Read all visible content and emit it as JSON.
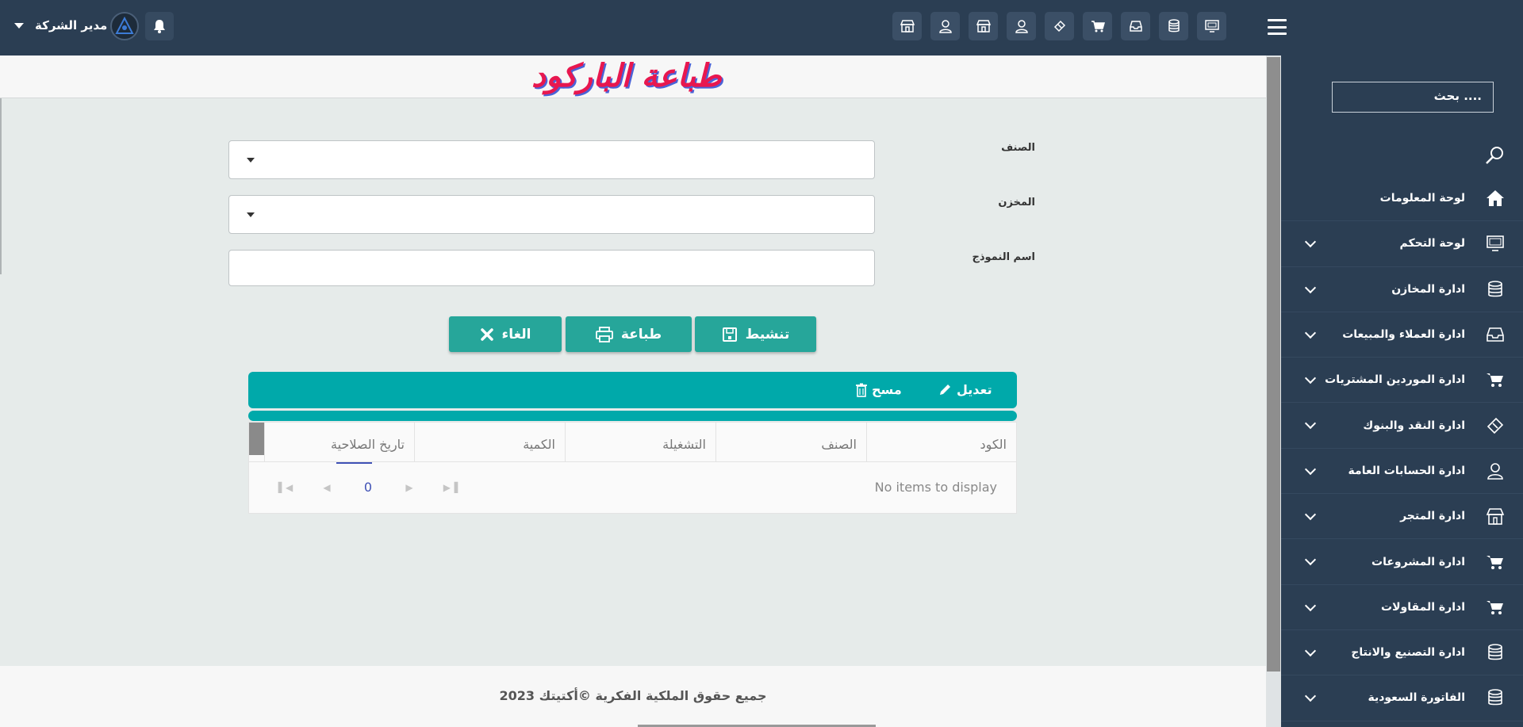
{
  "topbar": {
    "user_label": "مدير الشركة",
    "top_icons": [
      "monitor-icon",
      "database-icon",
      "inbox-icon",
      "cart-icon",
      "ticket-icon",
      "user-icon",
      "store-icon",
      "user-icon",
      "store-icon"
    ]
  },
  "sidebar": {
    "search_placeholder": "بحث ....",
    "items": [
      {
        "label": "لوحة المعلومات",
        "icon": "home-icon",
        "has_children": false
      },
      {
        "label": "لوحة التحكم",
        "icon": "monitor-icon",
        "has_children": true
      },
      {
        "label": "ادارة المخازن",
        "icon": "database-icon",
        "has_children": true
      },
      {
        "label": "ادارة العملاء والمبيعات",
        "icon": "inbox-icon",
        "has_children": true
      },
      {
        "label": "ادارة الموردين المشتريات",
        "icon": "cart-icon",
        "has_children": true
      },
      {
        "label": "ادارة النقد والبنوك",
        "icon": "ticket-icon",
        "has_children": true
      },
      {
        "label": "ادارة الحسابات العامة",
        "icon": "user-icon",
        "has_children": true
      },
      {
        "label": "ادارة المتجر",
        "icon": "store-icon",
        "has_children": true
      },
      {
        "label": "ادارة المشروعات",
        "icon": "cart-icon",
        "has_children": true
      },
      {
        "label": "ادارة المقاولات",
        "icon": "cart-icon",
        "has_children": true
      },
      {
        "label": "ادارة التصنيع والانتاج",
        "icon": "database-icon",
        "has_children": true
      },
      {
        "label": "الفاتورة السعودية",
        "icon": "database-icon",
        "has_children": true
      }
    ]
  },
  "page": {
    "title": "طباعة الباركود"
  },
  "form": {
    "item_label": "الصنف",
    "item_value": "",
    "store_label": "المخزن",
    "store_value": "",
    "template_label": "اسم النموذج",
    "template_value": ""
  },
  "actions": {
    "activate": "تنشيط",
    "print": "طباعة",
    "cancel": "الغاء"
  },
  "grid": {
    "edit": "تعديل",
    "delete": "مسح",
    "columns": [
      "الكود",
      "الصنف",
      "التشغيلة",
      "الكمية",
      "تاريخ الصلاحية"
    ],
    "empty_message": "No items to display",
    "page_number": "0"
  },
  "footer": {
    "text": "جميع حقوق الملكية الفكرية ©أكتيتك 2023"
  },
  "colors": {
    "topbar": "#2b3e53",
    "accent": "#26a69a",
    "toolbar": "#00a9aa",
    "title": "#e8174f"
  }
}
